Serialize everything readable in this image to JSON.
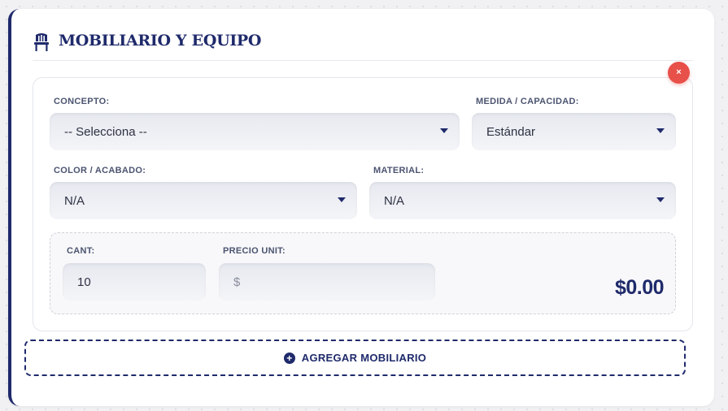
{
  "section": {
    "title": "MOBILIARIO Y EQUIPO",
    "icon": "chair-icon"
  },
  "item": {
    "close_label": "×",
    "concepto": {
      "label": "CONCEPTO:",
      "value": "-- Selecciona --"
    },
    "medida": {
      "label": "MEDIDA / CAPACIDAD:",
      "value": "Estándar"
    },
    "color": {
      "label": "COLOR / ACABADO:",
      "value": "N/A"
    },
    "material": {
      "label": "MATERIAL:",
      "value": "N/A"
    },
    "cantidad": {
      "label": "CANT:",
      "value": "10"
    },
    "precio": {
      "label": "PRECIO UNIT:",
      "placeholder": "$"
    },
    "total": "$0.00"
  },
  "add_button": {
    "label": "AGREGAR MOBILIARIO",
    "icon": "plus-circle-icon"
  },
  "colors": {
    "primary": "#1f2a6b",
    "danger": "#e8504a"
  }
}
